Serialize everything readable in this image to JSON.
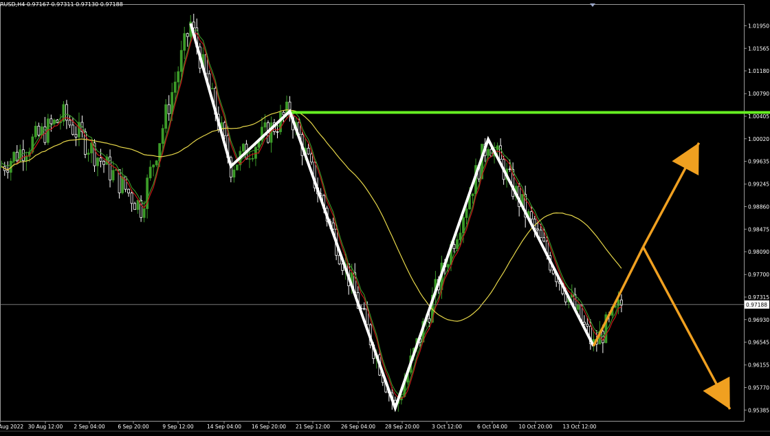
{
  "header": {
    "title": "RUSD,H4  0.97167 0.97311 0.97130 0.97188"
  },
  "colors": {
    "background": "#000000",
    "bull_candle": "#3c9b29",
    "bear_candle": "#ffffff",
    "ma_fast": "#c81818",
    "ma_slow": "#e8d84a",
    "resistance": "#66ee22",
    "zigzag": "#ffffff",
    "projection": "#f0a020",
    "axis": "#9a9a9a"
  },
  "chart_data": {
    "type": "candlestick",
    "symbol_info": "RUSD,H4  0.97167 0.97311 0.97130 0.97188",
    "ylim": [
      0.952,
      1.0232
    ],
    "y_ticks": [
      "1.01950",
      "1.01565",
      "1.01180",
      "1.00790",
      "1.00405",
      "1.00020",
      "0.99635",
      "0.99245",
      "0.98860",
      "0.98475",
      "0.98090",
      "0.97700",
      "0.97315",
      "0.96930",
      "0.96545",
      "0.96155",
      "0.95770",
      "0.95385"
    ],
    "x_ticks": [
      "Aug 2022",
      "30 Aug 12:00",
      "2 Sep 04:00",
      "6 Sep 20:00",
      "9 Sep 12:00",
      "14 Sep 04:00",
      "16 Sep 20:00",
      "21 Sep 12:00",
      "26 Sep 04:00",
      "28 Sep 20:00",
      "3 Oct 12:00",
      "6 Oct 04:00",
      "10 Oct 20:00",
      "13 Oct 12:00"
    ],
    "current_price": "0.97188",
    "resistance_level": 1.0047,
    "zigzag_points": [
      {
        "bar": 61,
        "price": 1.0199
      },
      {
        "bar": 74,
        "price": 0.9955
      },
      {
        "bar": 93,
        "price": 1.0049
      },
      {
        "bar": 127,
        "price": 0.9542
      },
      {
        "bar": 157,
        "price": 1.0001
      },
      {
        "bar": 191,
        "price": 0.9648
      }
    ],
    "projection": [
      {
        "bar": 191,
        "price": 0.9648
      },
      {
        "bar": 207,
        "price": 0.9817
      },
      {
        "bar": 225,
        "price": 0.9995
      },
      {
        "bar": 207,
        "price": 0.9817
      },
      {
        "bar": 235,
        "price": 0.954
      }
    ],
    "candles_approx": [
      [
        0.9965,
        0.9985,
        0.9935,
        0.9955
      ],
      [
        0.9955,
        0.997,
        0.992,
        0.993
      ],
      [
        0.993,
        0.996,
        0.9915,
        0.9952
      ],
      [
        0.9952,
        1.001,
        0.9945,
        1.0002
      ],
      [
        1.0002,
        1.003,
        0.999,
        1.002
      ],
      [
        1.002,
        1.004,
        0.9995,
        1.0005
      ],
      [
        1.0005,
        1.0025,
        0.998,
        0.999
      ],
      [
        0.999,
        1.0035,
        0.9985,
        1.003
      ],
      [
        1.003,
        1.005,
        1.001,
        1.004
      ],
      [
        1.004,
        1.0055,
        1.002,
        1.0025
      ],
      [
        1.0025,
        1.0045,
        1.0,
        1.0035
      ],
      [
        1.0035,
        1.006,
        1.002,
        1.005
      ],
      [
        1.005,
        1.0065,
        1.003,
        1.004
      ],
      [
        1.004,
        1.0055,
        1.001,
        1.002
      ],
      [
        1.002,
        1.0045,
        1.0,
        1.0038
      ],
      [
        1.0038,
        1.0058,
        1.0025,
        1.0048
      ],
      [
        1.0048,
        1.0062,
        1.002,
        1.003
      ],
      [
        1.003,
        1.004,
        0.999,
        1.0
      ],
      [
        1.0,
        1.0025,
        0.9975,
        0.9985
      ],
      [
        0.9985,
        1.001,
        0.9955,
        0.9965
      ],
      [
        0.9965,
        0.999,
        0.994,
        0.9975
      ],
      [
        0.9975,
        1.0,
        0.995,
        0.999
      ],
      [
        0.999,
        1.002,
        0.997,
        1.001
      ],
      [
        1.001,
        1.003,
        0.999,
        0.9995
      ],
      [
        0.9995,
        1.0005,
        0.996,
        0.997
      ],
      [
        0.997,
        0.9985,
        0.9925,
        0.9935
      ],
      [
        0.9935,
        0.9955,
        0.9905,
        0.992
      ],
      [
        0.992,
        0.995,
        0.99,
        0.994
      ],
      [
        0.994,
        0.997,
        0.9925,
        0.996
      ],
      [
        0.996,
        0.998,
        0.9935,
        0.9945
      ],
      [
        0.9945,
        0.996,
        0.9905,
        0.9915
      ],
      [
        0.9915,
        0.9935,
        0.988,
        0.9895
      ],
      [
        0.9895,
        0.9925,
        0.988,
        0.9915
      ],
      [
        0.9915,
        0.994,
        0.9895,
        0.9905
      ],
      [
        0.9905,
        0.992,
        0.987,
        0.9885
      ],
      [
        0.9885,
        0.991,
        0.986,
        0.99
      ],
      [
        0.99,
        0.9935,
        0.989,
        0.9925
      ],
      [
        0.9925,
        0.996,
        0.9915,
        0.995
      ],
      [
        0.995,
        0.9985,
        0.994,
        0.9975
      ],
      [
        0.9975,
        1.001,
        0.9965,
        1.0
      ],
      [
        1.0,
        1.003,
        0.9985,
        1.002
      ],
      [
        1.002,
        1.0045,
        1.0,
        1.001
      ],
      [
        1.001,
        1.005,
        1.0,
        1.004
      ],
      [
        1.004,
        1.0085,
        1.003,
        1.0075
      ],
      [
        1.0075,
        1.011,
        1.006,
        1.0095
      ],
      [
        1.0095,
        1.013,
        1.007,
        1.008
      ],
      [
        1.008,
        1.012,
        1.0065,
        1.011
      ],
      [
        1.011,
        1.015,
        1.0095,
        1.014
      ],
      [
        1.014,
        1.0175,
        1.012,
        1.016
      ],
      [
        1.016,
        1.019,
        1.013,
        1.0145
      ],
      [
        1.0145,
        1.017,
        1.011,
        1.0125
      ],
      [
        1.0125,
        1.016,
        1.0115,
        1.015
      ],
      [
        1.015,
        1.0185,
        1.0135,
        1.0175
      ],
      [
        1.0175,
        1.0199,
        1.015,
        1.0165
      ],
      [
        1.0165,
        1.018,
        1.011,
        1.012
      ],
      [
        1.012,
        1.0135,
        1.005,
        1.006
      ],
      [
        1.006,
        1.008,
        1.0,
        1.001
      ],
      [
        1.001,
        1.003,
        0.996,
        0.9975
      ],
      [
        0.9975,
        0.9995,
        0.9945,
        0.996
      ],
      [
        0.996,
        0.999,
        0.995,
        0.998
      ],
      [
        0.998,
        1.001,
        0.9965,
        0.9995
      ],
      [
        0.9995,
        1.002,
        0.9975,
        1.0005
      ],
      [
        1.0005,
        1.003,
        0.999,
        1.0015
      ],
      [
        1.0015,
        1.004,
        1.0,
        1.0025
      ],
      [
        1.0025,
        1.0049,
        1.001,
        1.004
      ],
      [
        1.004,
        1.0045,
        0.999,
        1.0
      ],
      [
        1.0,
        1.001,
        0.994,
        0.995
      ],
      [
        0.995,
        0.9965,
        0.988,
        0.989
      ],
      [
        0.989,
        0.99,
        0.983,
        0.984
      ],
      [
        0.984,
        0.986,
        0.979,
        0.98
      ],
      [
        0.98,
        0.982,
        0.974,
        0.975
      ],
      [
        0.975,
        0.9765,
        0.969,
        0.97
      ],
      [
        0.97,
        0.972,
        0.962,
        0.964
      ],
      [
        0.964,
        0.967,
        0.956,
        0.959
      ],
      [
        0.959,
        0.964,
        0.9555,
        0.962
      ],
      [
        0.962,
        0.965,
        0.957,
        0.958
      ],
      [
        0.958,
        0.96,
        0.9542,
        0.9555
      ],
      [
        0.9555,
        0.962,
        0.9548,
        0.961
      ],
      [
        0.961,
        0.969,
        0.96,
        0.968
      ],
      [
        0.968,
        0.975,
        0.967,
        0.974
      ],
      [
        0.974,
        0.98,
        0.972,
        0.979
      ],
      [
        0.979,
        0.984,
        0.976,
        0.983
      ],
      [
        0.983,
        0.985,
        0.978,
        0.98
      ],
      [
        0.98,
        0.983,
        0.976,
        0.9815
      ],
      [
        0.9815,
        0.986,
        0.98,
        0.985
      ],
      [
        0.985,
        0.99,
        0.9835,
        0.989
      ],
      [
        0.989,
        0.995,
        0.988,
        0.994
      ],
      [
        0.994,
        0.9985,
        0.9925,
        0.9975
      ],
      [
        0.9975,
        1.0001,
        0.995,
        0.996
      ],
      [
        0.996,
        0.997,
        0.989,
        0.99
      ],
      [
        0.99,
        0.992,
        0.984,
        0.985
      ],
      [
        0.985,
        0.987,
        0.979,
        0.98
      ],
      [
        0.98,
        0.983,
        0.976,
        0.977
      ],
      [
        0.977,
        0.979,
        0.972,
        0.973
      ],
      [
        0.973,
        0.976,
        0.97,
        0.9715
      ],
      [
        0.9715,
        0.974,
        0.968,
        0.9695
      ],
      [
        0.9695,
        0.972,
        0.967,
        0.971
      ],
      [
        0.971,
        0.973,
        0.966,
        0.9675
      ],
      [
        0.9675,
        0.97,
        0.965,
        0.969
      ],
      [
        0.969,
        0.972,
        0.968,
        0.97
      ],
      [
        0.97,
        0.9715,
        0.9655,
        0.9665
      ],
      [
        0.9665,
        0.97,
        0.9648,
        0.969
      ],
      [
        0.969,
        0.976,
        0.968,
        0.975
      ],
      [
        0.975,
        0.981,
        0.9735,
        0.9795
      ],
      [
        0.9795,
        0.9808,
        0.9755,
        0.977
      ],
      [
        0.977,
        0.979,
        0.971,
        0.9719
      ]
    ]
  }
}
